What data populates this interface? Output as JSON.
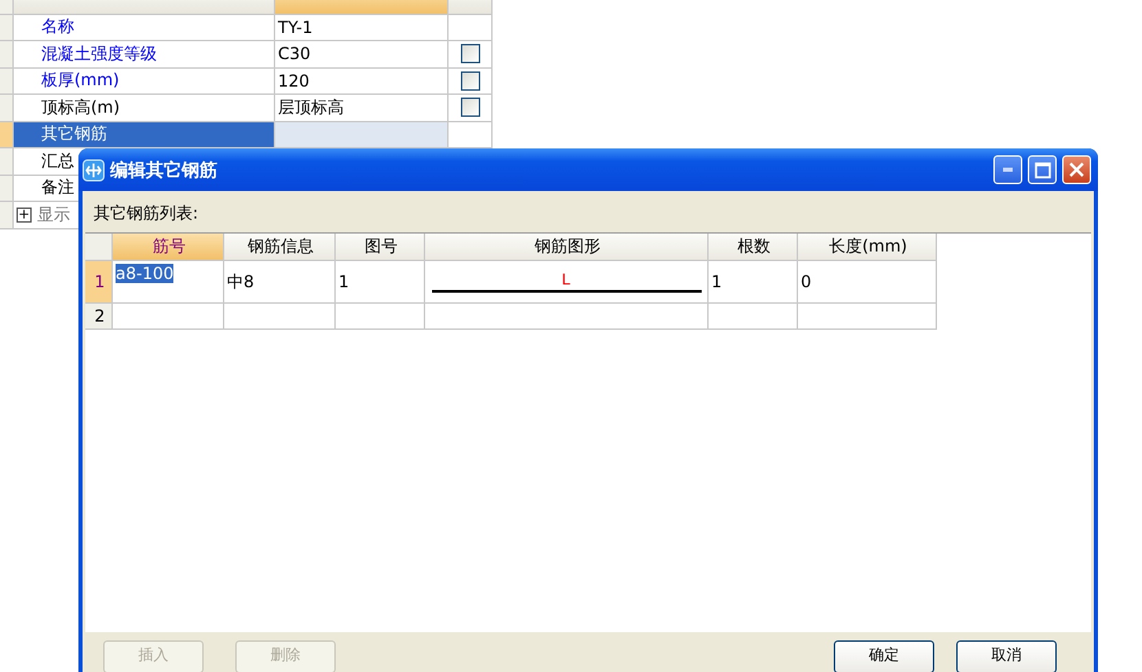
{
  "property_panel": {
    "columns": [
      {
        "selected": false
      },
      {
        "selected": true
      },
      {
        "selected": false
      }
    ],
    "rows": [
      {
        "kind": "field",
        "name": "名称",
        "value": "TY-1",
        "public": true,
        "selected": false
      },
      {
        "kind": "checkbox",
        "name": "混凝土强度等级",
        "value": "C30",
        "public": true,
        "selected": false,
        "checked": false
      },
      {
        "kind": "checkbox",
        "name": "板厚(mm)",
        "value": "120",
        "public": true,
        "selected": false,
        "checked": false
      },
      {
        "kind": "checkbox",
        "name": "顶标高(m)",
        "value": "层顶标高",
        "public": false,
        "selected": false,
        "checked": false
      },
      {
        "kind": "field",
        "name": "其它钢筋",
        "selected": true
      },
      {
        "kind": "field",
        "name": "汇总",
        "public": false,
        "selected": false
      },
      {
        "kind": "field",
        "name": "备注",
        "public": false,
        "selected": false
      },
      {
        "kind": "group",
        "name": "显示",
        "public": false,
        "selected": false,
        "expanded": false,
        "expander": "+"
      }
    ]
  },
  "dialog": {
    "title": "编辑其它钢筋",
    "list_label": "其它钢筋列表:",
    "grid": {
      "columns": [
        {
          "label": "筋号",
          "selected": true
        },
        {
          "label": "钢筋信息",
          "selected": false
        },
        {
          "label": "图号",
          "selected": false
        },
        {
          "label": "钢筋图形",
          "selected": false
        },
        {
          "label": "根数",
          "selected": false
        },
        {
          "label": "长度(mm)",
          "selected": false
        }
      ],
      "rows": [
        {
          "number": "1",
          "selected": true,
          "bar_no": "a8-100",
          "info": "中8",
          "figure_no": "1",
          "shape_label": "L",
          "count": "1",
          "length": "0"
        },
        {
          "number": "2",
          "selected": false
        }
      ]
    },
    "buttons": [
      {
        "label": "插入",
        "disabled": true
      },
      {
        "label": "删除",
        "disabled": true
      },
      {
        "label": "确定",
        "disabled": false
      },
      {
        "label": "取消",
        "disabled": false
      }
    ]
  }
}
